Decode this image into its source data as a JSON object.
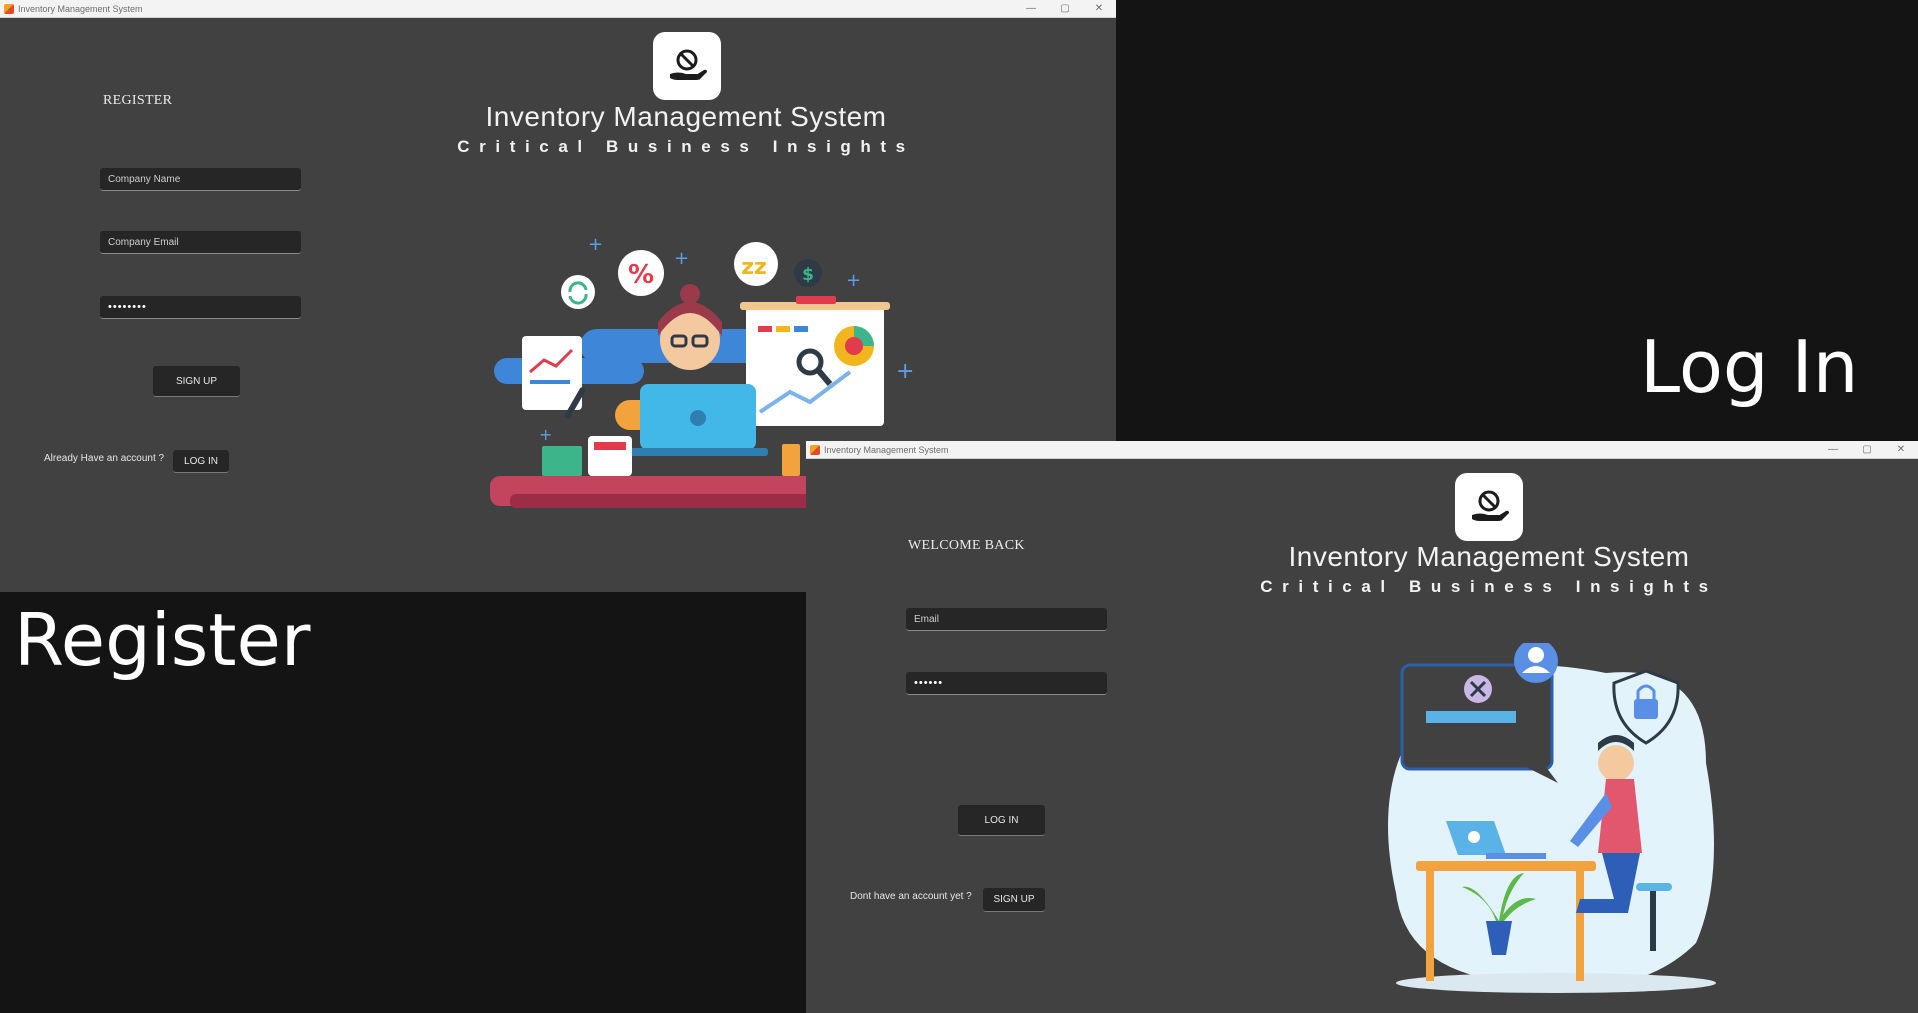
{
  "register_window": {
    "title": "Inventory Management System",
    "controls": {
      "minimize": "—",
      "maximize": "▢",
      "close": "✕"
    },
    "app_title": "Inventory Management System",
    "app_subtitle": "Critical Business Insights",
    "heading": "REGISTER",
    "company_name_placeholder": "Company Name",
    "company_email_placeholder": "Company Email",
    "password_value": "••••••••",
    "signup_label": "SIGN UP",
    "account_prompt": "Already Have an account ?",
    "login_label": "LOG IN"
  },
  "login_window": {
    "title": "Inventory Management System",
    "controls": {
      "minimize": "—",
      "maximize": "▢",
      "close": "✕"
    },
    "app_title": "Inventory Management System",
    "app_subtitle": "Critical Business Insights",
    "heading": "WELCOME BACK",
    "email_placeholder": "Email",
    "password_value": "••••••",
    "login_label": "LOG IN",
    "account_prompt": "Dont have an account yet ?",
    "signup_label": "SIGN UP"
  },
  "captions": {
    "login": "Log In",
    "register": "Register"
  },
  "colors": {
    "background": "#141414",
    "window": "#414141",
    "field": "#262626",
    "text": "#f2f2f2"
  }
}
